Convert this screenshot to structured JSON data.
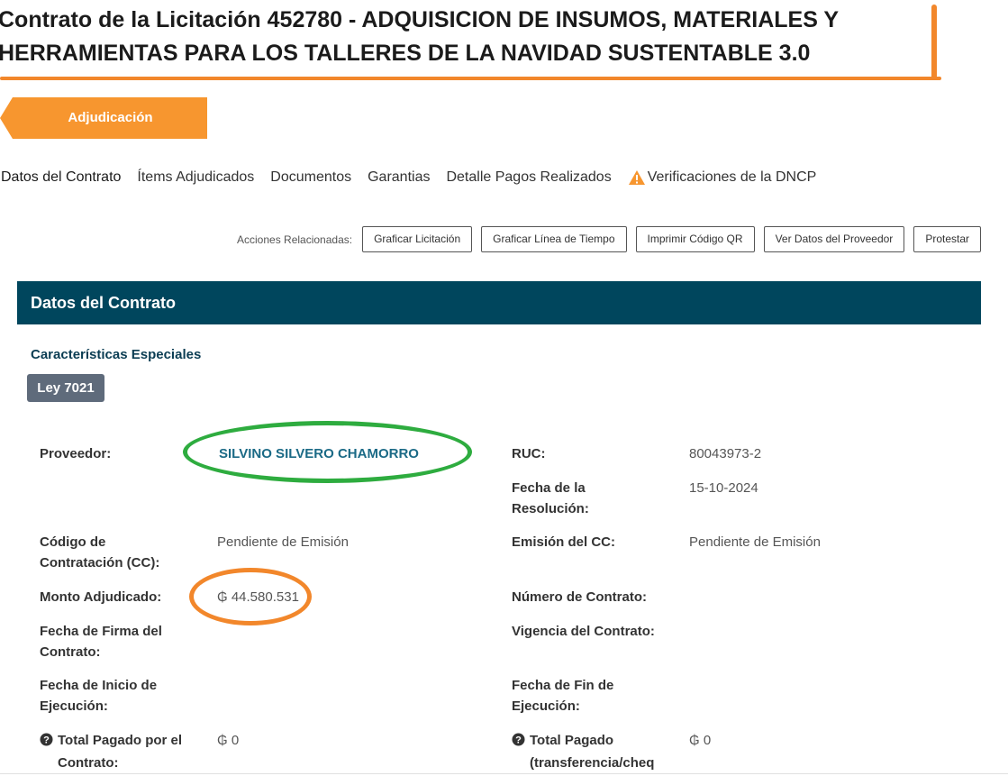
{
  "page": {
    "title_line1": "Contrato de la Licitación 452780 - ADQUISICION DE INSUMOS, MATERIALES Y",
    "title_line2": "HERRAMIENTAS PARA LOS TALLERES DE LA NAVIDAD SUSTENTABLE 3.0"
  },
  "stage": {
    "label": "Adjudicación",
    "color": "#f7962f"
  },
  "tabs": [
    {
      "label": "Datos del Contrato",
      "active": true
    },
    {
      "label": "Ítems Adjudicados"
    },
    {
      "label": "Documentos"
    },
    {
      "label": "Garantias"
    },
    {
      "label": "Detalle Pagos Realizados"
    },
    {
      "label": "Verificaciones de la DNCP",
      "icon": "warning-icon"
    }
  ],
  "actions": {
    "label": "Acciones Relacionadas:",
    "buttons": [
      "Graficar Licitación",
      "Graficar Línea de Tiempo",
      "Imprimir Código QR",
      "Ver Datos del Proveedor",
      "Protestar"
    ]
  },
  "section": {
    "title": "Datos del Contrato",
    "header_color": "#00465d",
    "special_label": "Características Especiales",
    "badge": "Ley 7021"
  },
  "fields": {
    "proveedor": {
      "label": "Proveedor:",
      "value": "SILVINO SILVERO CHAMORRO"
    },
    "ruc": {
      "label": "RUC:",
      "value": "80043973-2"
    },
    "fecha_resolucion": {
      "label_line1": "Fecha de la",
      "label_line2": "Resolución:",
      "value": "15-10-2024"
    },
    "codigo_cc": {
      "label_line1": "Código de",
      "label_line2": "Contratación (CC):",
      "value": "Pendiente de Emisión"
    },
    "emision_cc": {
      "label": "Emisión del CC:",
      "value": "Pendiente de Emisión"
    },
    "monto": {
      "label": "Monto Adjudicado:",
      "value": "₲ 44.580.531"
    },
    "numero_contrato": {
      "label": "Número de Contrato:"
    },
    "fecha_firma": {
      "label_line1": "Fecha de Firma del",
      "label_line2": "Contrato:"
    },
    "vigencia": {
      "label": "Vigencia del Contrato:"
    },
    "fecha_inicio": {
      "label_line1": "Fecha de Inicio de",
      "label_line2": "Ejecución:"
    },
    "fecha_fin": {
      "label_line1": "Fecha de Fin de",
      "label_line2": "Ejecución:"
    },
    "total_contrato": {
      "label_line1": "Total Pagado por el",
      "label_line2": "Contrato:",
      "value": "₲ 0"
    },
    "total_transferencia": {
      "label_line1": "Total Pagado",
      "label_line2": "(transferencia/cheq",
      "value": "₲ 0"
    }
  },
  "annotations": {
    "green": "#2eac3f",
    "orange": "#f2872b"
  }
}
